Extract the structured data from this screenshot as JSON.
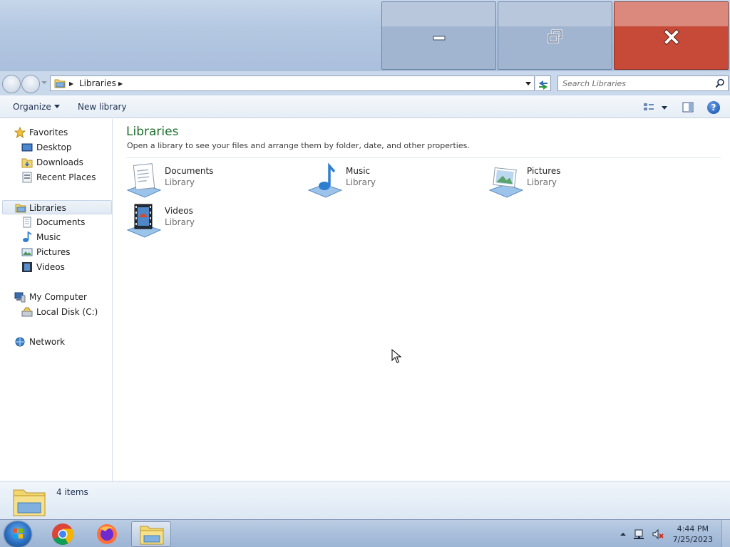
{
  "window": {
    "minimize_icon": "minimize-icon",
    "maximize_icon": "restore-icon",
    "close_icon": "close-icon",
    "close_color": "#c64a37"
  },
  "address": {
    "breadcrumb": "Libraries",
    "search_placeholder": "Search Libraries"
  },
  "toolbar": {
    "organize_label": "Organize",
    "new_library_label": "New library"
  },
  "sidebar": {
    "favorites": {
      "label": "Favorites",
      "items": [
        {
          "label": "Desktop"
        },
        {
          "label": "Downloads"
        },
        {
          "label": "Recent Places"
        }
      ]
    },
    "libraries": {
      "label": "Libraries",
      "items": [
        {
          "label": "Documents"
        },
        {
          "label": "Music"
        },
        {
          "label": "Pictures"
        },
        {
          "label": "Videos"
        }
      ]
    },
    "computer": {
      "label": "My Computer",
      "items": [
        {
          "label": "Local Disk (C:)"
        }
      ]
    },
    "network": {
      "label": "Network"
    }
  },
  "content": {
    "title": "Libraries",
    "description": "Open a library to see your files and arrange them by folder, date, and other properties.",
    "title_color": "#1e6e2c",
    "items": [
      {
        "name": "Documents",
        "type": "Library",
        "icon": "documents-library-icon"
      },
      {
        "name": "Music",
        "type": "Library",
        "icon": "music-library-icon"
      },
      {
        "name": "Pictures",
        "type": "Library",
        "icon": "pictures-library-icon"
      },
      {
        "name": "Videos",
        "type": "Library",
        "icon": "videos-library-icon"
      }
    ]
  },
  "details": {
    "count": "4 items"
  },
  "taskbar": {
    "apps": [
      "chrome-icon",
      "firefox-icon",
      "explorer-icon"
    ],
    "time": "4:44 PM",
    "date": "7/25/2023"
  }
}
